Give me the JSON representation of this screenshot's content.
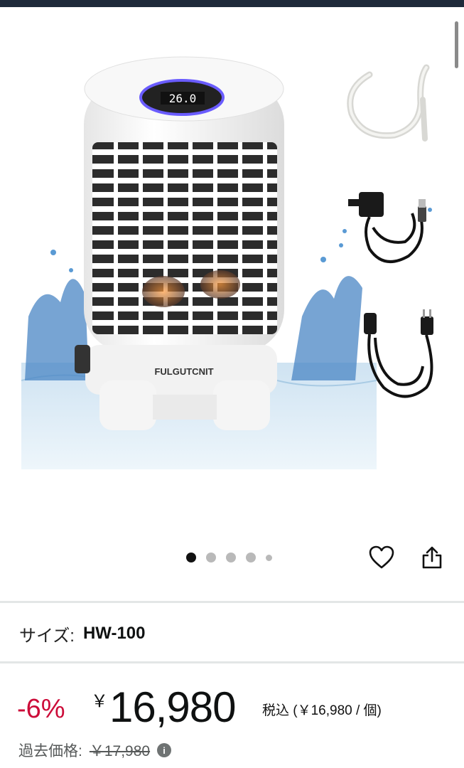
{
  "product": {
    "brand_label": "FULGUTCNIT",
    "display_value": "26.0",
    "image_count": 5,
    "active_image": 1
  },
  "actions": {
    "favorite_icon": "heart-icon",
    "share_icon": "share-icon"
  },
  "size": {
    "label": "サイズ:",
    "value": "HW-100"
  },
  "price": {
    "discount": "-6%",
    "currency_symbol": "￥",
    "amount": "16,980",
    "tax_note": "税込 (￥16,980 / 個)"
  },
  "past_price": {
    "label": "過去価格:",
    "value": "￥17,980",
    "info_icon": "i"
  },
  "colors": {
    "discount": "#cc0c39",
    "text": "#0f1111",
    "muted": "#565959",
    "display_ring": "#6a5cff"
  }
}
